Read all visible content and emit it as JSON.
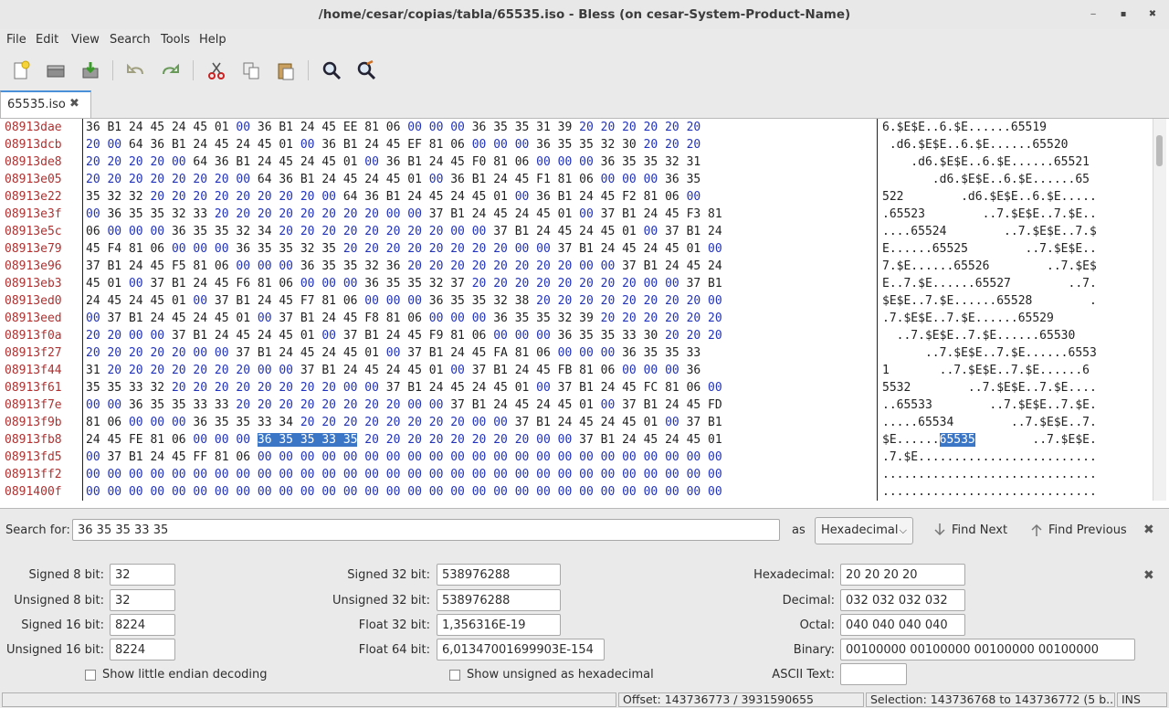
{
  "window": {
    "title": "/home/cesar/copias/tabla/65535.iso - Bless (on cesar-System-Product-Name)",
    "controls": {
      "minimize": "‒",
      "maximize": "▪",
      "close": "✖"
    }
  },
  "menu": [
    "File",
    "Edit",
    "View",
    "Search",
    "Tools",
    "Help"
  ],
  "toolbar": [
    "new-file-icon",
    "open-file-icon",
    "save-icon",
    "undo-icon",
    "redo-icon",
    "cut-icon",
    "copy-icon",
    "paste-icon",
    "find-icon",
    "find-replace-icon"
  ],
  "tab": {
    "label": "65535.iso",
    "close": "✖"
  },
  "hex": {
    "offsets": [
      "08913dae",
      "08913dcb",
      "08913de8",
      "08913e05",
      "08913e22",
      "08913e3f",
      "08913e5c",
      "08913e79",
      "08913e96",
      "08913eb3",
      "08913ed0",
      "08913eed",
      "08913f0a",
      "08913f27",
      "08913f44",
      "08913f61",
      "08913f7e",
      "08913f9b",
      "08913fb8",
      "08913fd5",
      "08913ff2",
      "0891400f"
    ],
    "rows": [
      "36 B1 24 45 24 45 01 00 36 B1 24 45 EE 81 06 00 00 00 36 35 35 31 39 20 20 20 20 20 20",
      "20 00 64 36 B1 24 45 24 45 01 00 36 B1 24 45 EF 81 06 00 00 00 36 35 35 32 30 20 20 20",
      "20 20 20 20 00 64 36 B1 24 45 24 45 01 00 36 B1 24 45 F0 81 06 00 00 00 36 35 35 32 31",
      "20 20 20 20 20 20 20 00 64 36 B1 24 45 24 45 01 00 36 B1 24 45 F1 81 06 00 00 00 36 35",
      "35 32 32 20 20 20 20 20 20 20 20 00 64 36 B1 24 45 24 45 01 00 36 B1 24 45 F2 81 06 00",
      "00 36 35 35 32 33 20 20 20 20 20 20 20 20 00 00 37 B1 24 45 24 45 01 00 37 B1 24 45 F3 81",
      "06 00 00 00 36 35 35 32 34 20 20 20 20 20 20 20 20 00 00 37 B1 24 45 24 45 01 00 37 B1 24",
      "45 F4 81 06 00 00 00 36 35 35 32 35 20 20 20 20 20 20 20 20 00 00 37 B1 24 45 24 45 01 00",
      "37 B1 24 45 F5 81 06 00 00 00 36 35 35 32 36 20 20 20 20 20 20 20 20 00 00 37 B1 24 45 24",
      "45 01 00 37 B1 24 45 F6 81 06 00 00 00 36 35 35 32 37 20 20 20 20 20 20 20 20 00 00 37 B1",
      "24 45 24 45 01 00 37 B1 24 45 F7 81 06 00 00 00 36 35 35 32 38 20 20 20 20 20 20 20 20 00",
      "00 37 B1 24 45 24 45 01 00 37 B1 24 45 F8 81 06 00 00 00 36 35 35 32 39 20 20 20 20 20 20",
      "20 20 00 00 37 B1 24 45 24 45 01 00 37 B1 24 45 F9 81 06 00 00 00 36 35 35 33 30 20 20 20",
      "20 20 20 20 20 00 00 37 B1 24 45 24 45 01 00 37 B1 24 45 FA 81 06 00 00 00 36 35 35 33",
      "31 20 20 20 20 20 20 20 00 00 37 B1 24 45 24 45 01 00 37 B1 24 45 FB 81 06 00 00 00 36",
      "35 35 33 32 20 20 20 20 20 20 20 20 00 00 37 B1 24 45 24 45 01 00 37 B1 24 45 FC 81 06 00",
      "00 00 36 35 35 33 33 20 20 20 20 20 20 20 20 00 00 37 B1 24 45 24 45 01 00 37 B1 24 45 FD",
      "81 06 00 00 00 36 35 35 33 34 20 20 20 20 20 20 20 20 00 00 37 B1 24 45 24 45 01 00 37 B1",
      "24 45 FE 81 06 00 00 00 36 35 35 33 35 20 20 20 20 20 20 20 20 00 00 37 B1 24 45 24 45 01",
      "00 37 B1 24 45 FF 81 06 00 00 00 00 00 00 00 00 00 00 00 00 00 00 00 00 00 00 00 00 00 00",
      "00 00 00 00 00 00 00 00 00 00 00 00 00 00 00 00 00 00 00 00 00 00 00 00 00 00 00 00 00 00",
      "00 00 00 00 00 00 00 00 00 00 00 00 00 00 00 00 00 00 00 00 00 00 00 00 00 00 00 00 00 00"
    ],
    "ascii": [
      "6.$E$E..6.$E......65519      ",
      " .d6.$E$E..6.$E......65520   ",
      "    .d6.$E$E..6.$E......65521",
      "       .d6.$E$E..6.$E......65",
      "522        .d6.$E$E..6.$E.....",
      ".65523        ..7.$E$E..7.$E..",
      "....65524        ..7.$E$E..7.$",
      "E......65525        ..7.$E$E..",
      "7.$E......65526        ..7.$E$",
      "E..7.$E......65527        ..7.",
      "$E$E..7.$E......65528        .",
      ".7.$E$E..7.$E......65529      ",
      "  ..7.$E$E..7.$E......65530   ",
      "      ..7.$E$E..7.$E......6553",
      "1       ..7.$E$E..7.$E......6",
      "5532        ..7.$E$E..7.$E....",
      "..65533        ..7.$E$E..7.$E.",
      ".....65534        ..7.$E$E..7.",
      "$E......65535        ..7.$E$E.",
      ".7.$E.........................",
      "..............................",
      ".............................."
    ],
    "selection": {
      "row": 18,
      "start": 8,
      "end": 12
    }
  },
  "search": {
    "label": "Search for:",
    "value": "36 35 35 33 35",
    "as_label": "as",
    "mode": "Hexadecimal",
    "find_next": "Find Next",
    "find_previous": "Find Previous"
  },
  "conversion": {
    "signed8_label": "Signed 8 bit:",
    "signed8": "32",
    "unsigned8_label": "Unsigned 8 bit:",
    "unsigned8": "32",
    "signed16_label": "Signed 16 bit:",
    "signed16": "8224",
    "unsigned16_label": "Unsigned 16 bit:",
    "unsigned16": "8224",
    "signed32_label": "Signed 32 bit:",
    "signed32": "538976288",
    "unsigned32_label": "Unsigned 32 bit:",
    "unsigned32": "538976288",
    "float32_label": "Float 32 bit:",
    "float32": "1,356316E-19",
    "float64_label": "Float 64 bit:",
    "float64": "6,01347001699903E-154",
    "hex_label": "Hexadecimal:",
    "hex": "20 20 20 20",
    "decimal_label": "Decimal:",
    "decimal": "032 032 032 032",
    "octal_label": "Octal:",
    "octal": "040 040 040 040",
    "binary_label": "Binary:",
    "binary": "00100000 00100000 00100000 00100000",
    "ascii_label": "ASCII Text:",
    "ascii": "",
    "little_endian_label": "Show little endian decoding",
    "unsigned_hex_label": "Show unsigned as hexadecimal"
  },
  "status": {
    "offset": "Offset: 143736773 / 3931590655",
    "selection": "Selection: 143736768 to 143736772 (5 b...",
    "mode": "INS"
  },
  "colors": {
    "accent": "#3b76c6",
    "offset_text": "#b03030",
    "hex_alt": "#2233bb"
  }
}
